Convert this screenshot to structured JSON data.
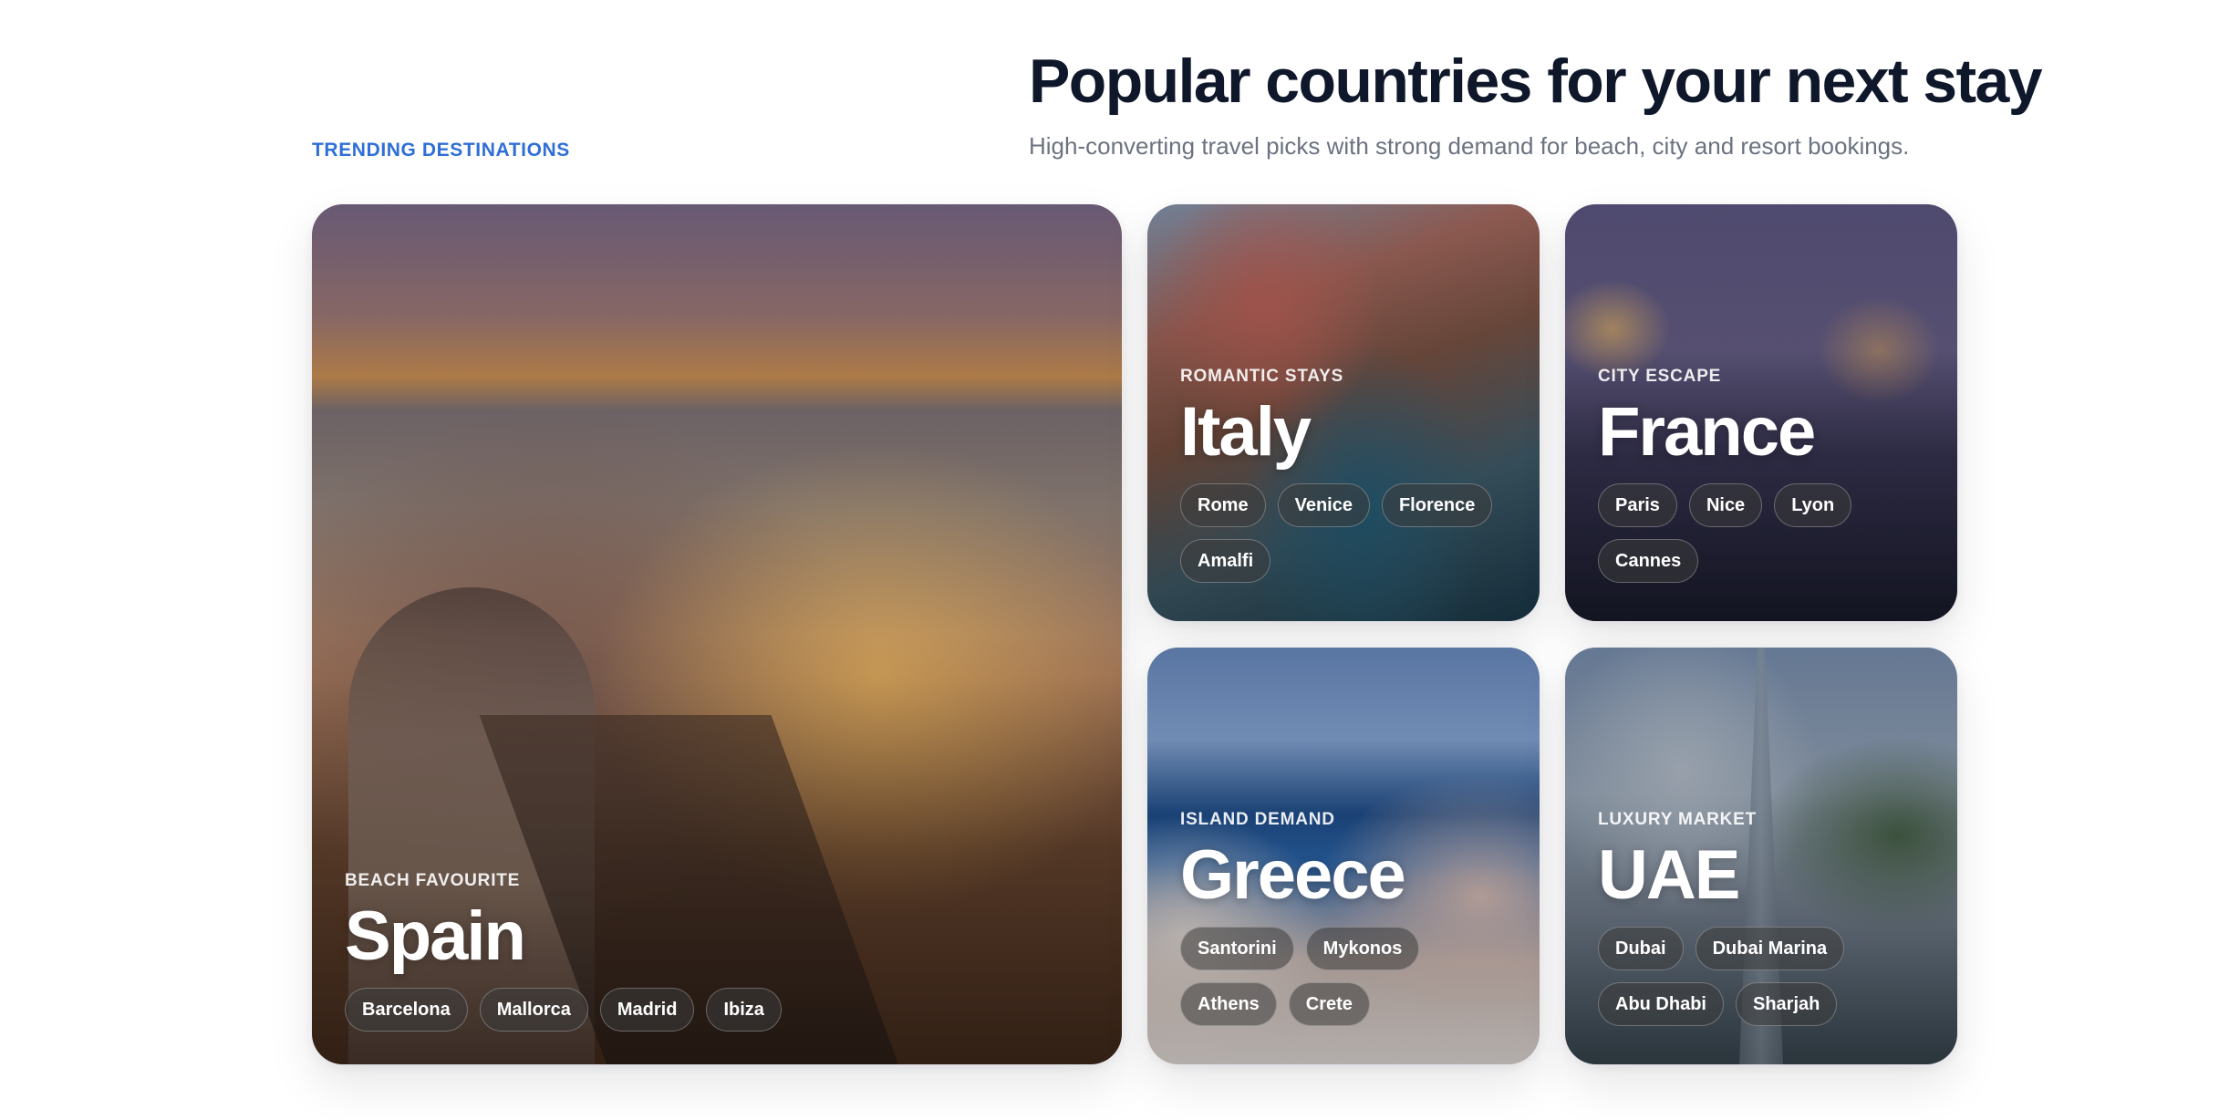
{
  "section": {
    "eyebrow": "TRENDING DESTINATIONS",
    "title": "Popular countries for your next stay",
    "subtitle": "High-converting travel picks with strong demand for beach, city and resort bookings."
  },
  "cards": {
    "spain": {
      "tagline": "BEACH FAVOURITE",
      "country": "Spain",
      "cities": [
        "Barcelona",
        "Mallorca",
        "Madrid",
        "Ibiza"
      ]
    },
    "italy": {
      "tagline": "ROMANTIC STAYS",
      "country": "Italy",
      "cities": [
        "Rome",
        "Venice",
        "Florence",
        "Amalfi"
      ]
    },
    "france": {
      "tagline": "CITY ESCAPE",
      "country": "France",
      "cities": [
        "Paris",
        "Nice",
        "Lyon",
        "Cannes"
      ]
    },
    "greece": {
      "tagline": "ISLAND DEMAND",
      "country": "Greece",
      "cities": [
        "Santorini",
        "Mykonos",
        "Athens",
        "Crete"
      ]
    },
    "uae": {
      "tagline": "LUXURY MARKET",
      "country": "UAE",
      "cities": [
        "Dubai",
        "Dubai Marina",
        "Abu Dhabi",
        "Sharjah"
      ]
    }
  },
  "colors": {
    "accent": "#2f6fd6",
    "heading": "#0f172a",
    "muted": "#6b7280"
  }
}
